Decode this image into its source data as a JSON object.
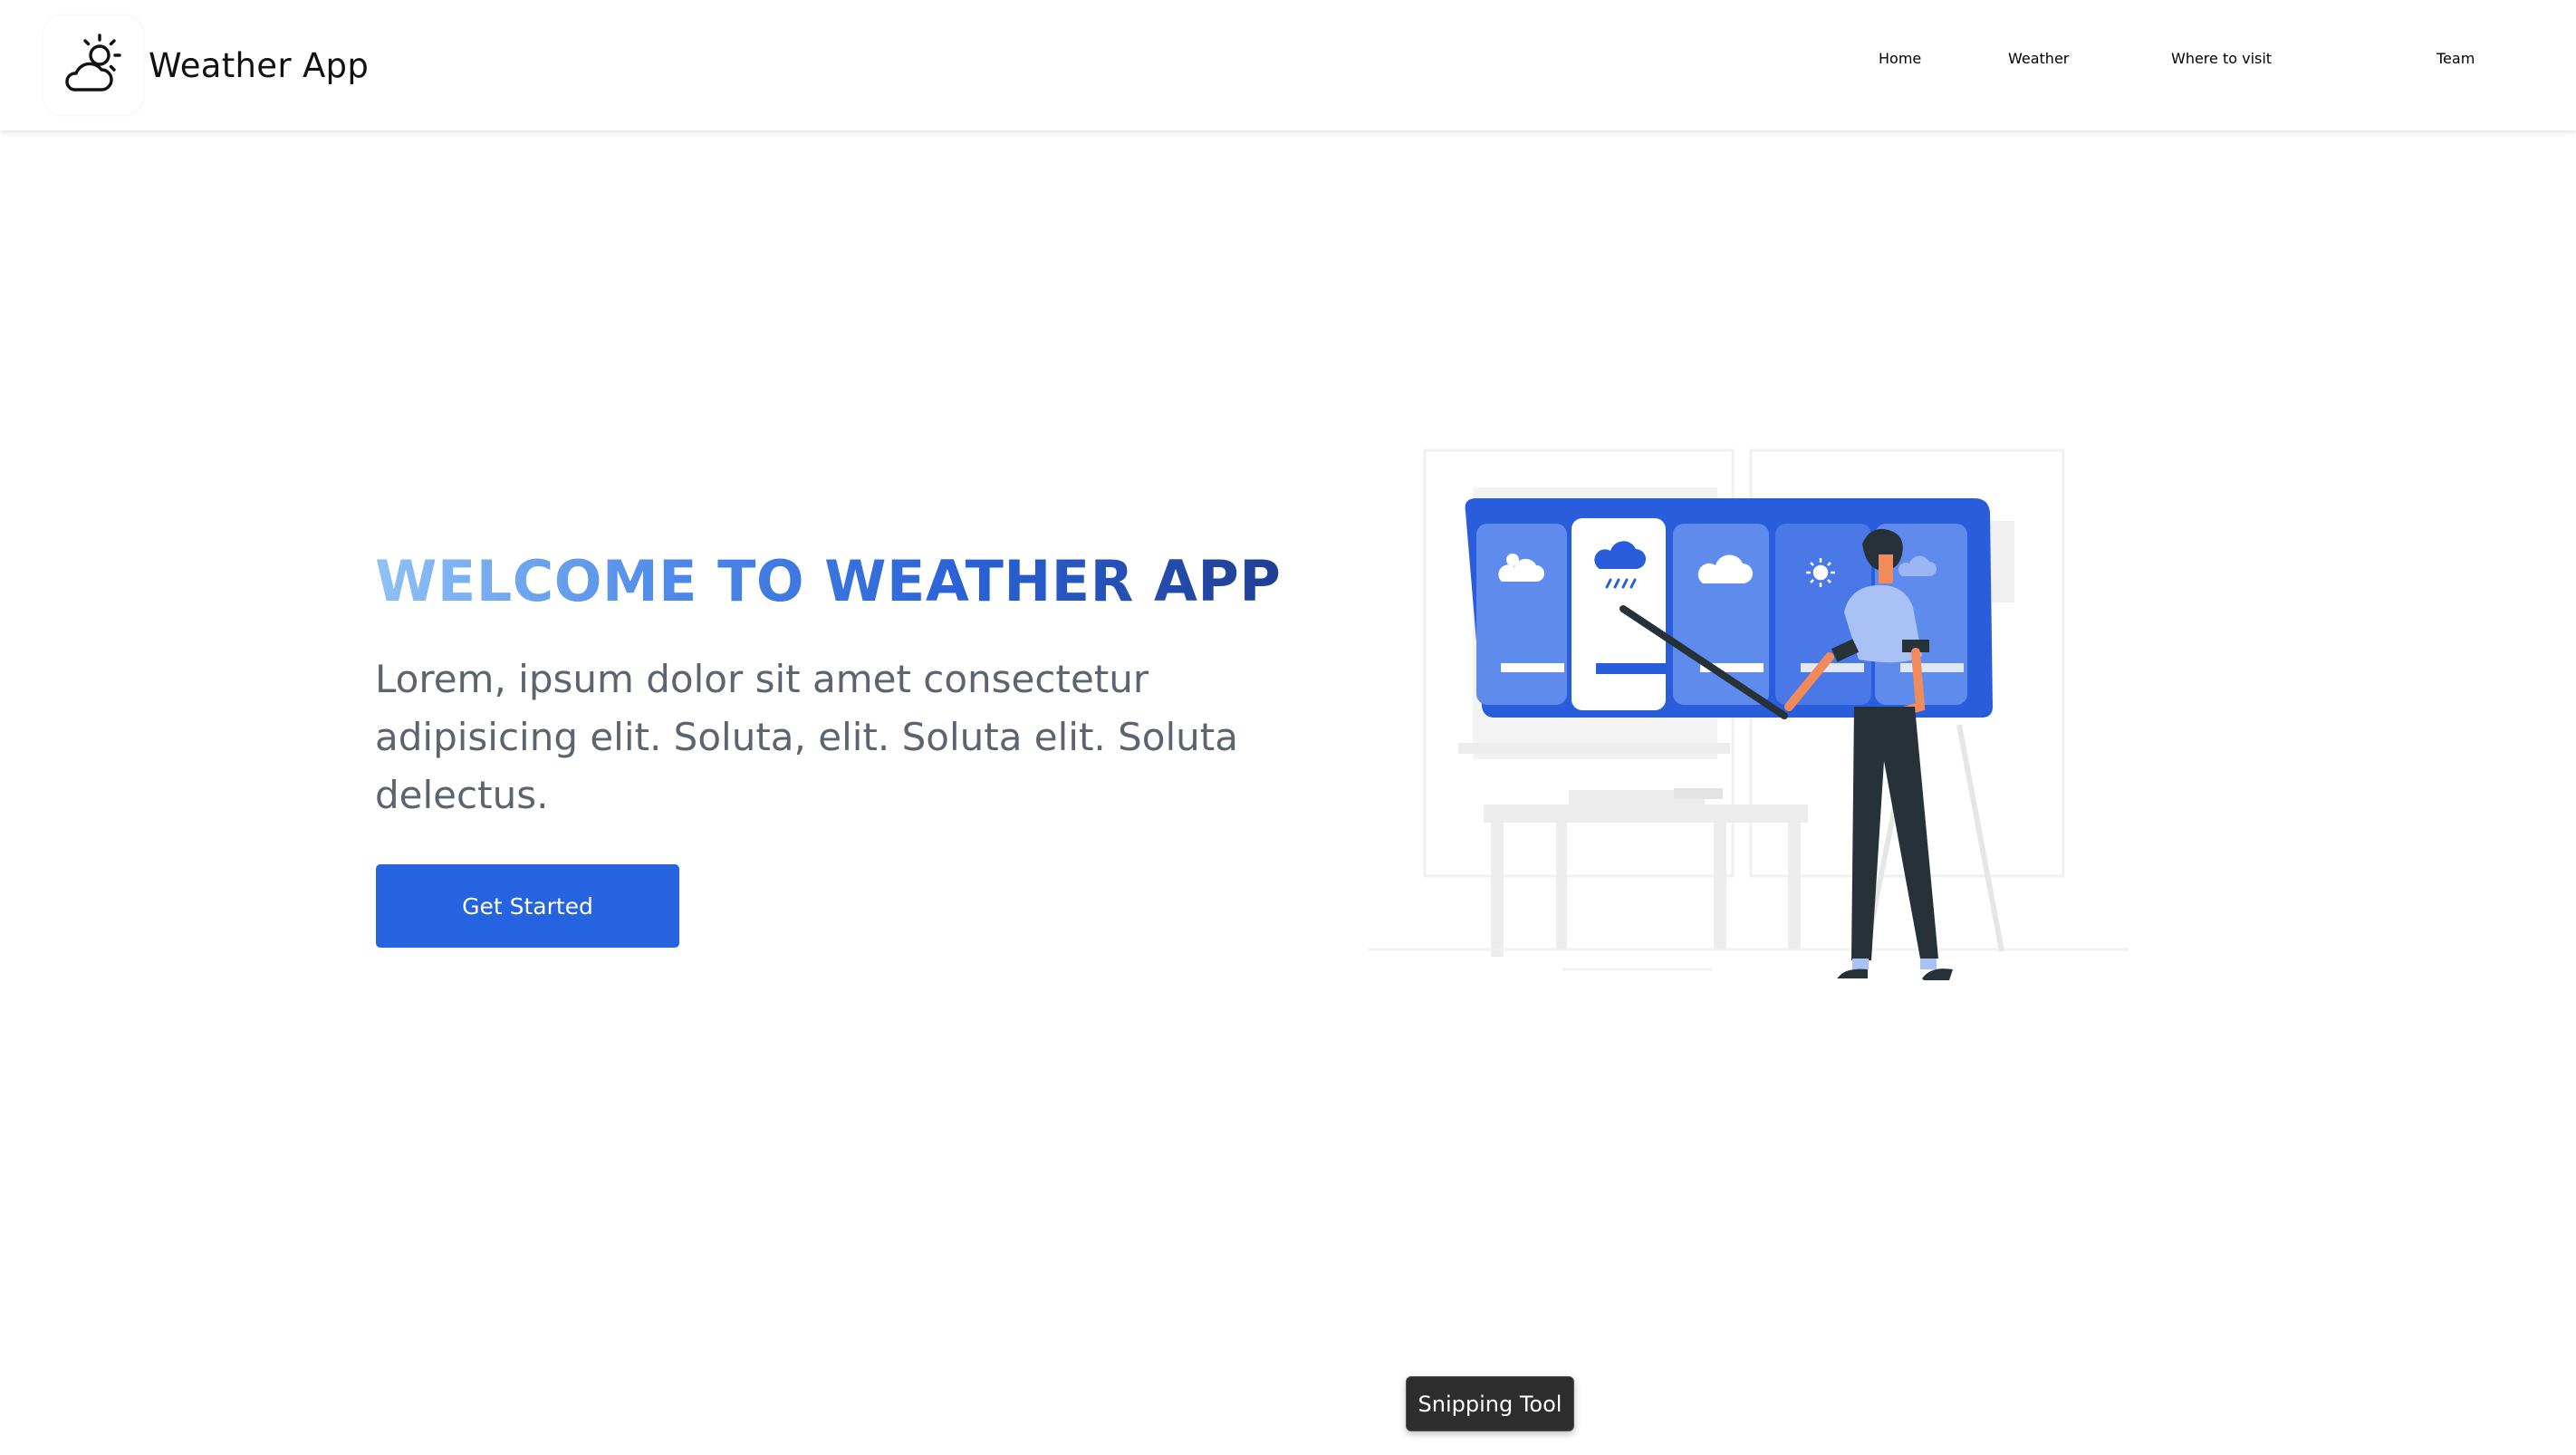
{
  "brand": {
    "title": "Weather App",
    "logo_icon": "cloud-sun-icon"
  },
  "nav": {
    "items": [
      {
        "label": "Home"
      },
      {
        "label": "Weather"
      },
      {
        "label": "Where to visit"
      },
      {
        "label": "Team"
      }
    ]
  },
  "hero": {
    "title": "WELCOME TO WEATHER APP",
    "description": "Lorem, ipsum dolor sit amet consectetur adipisicing elit. Soluta, elit. Soluta elit. Soluta delectus.",
    "cta_label": "Get Started"
  },
  "illustration": {
    "subject": "person-pointing-at-weather-board",
    "cards": [
      "partly-cloudy-icon",
      "rain-cloud-icon",
      "cloud-icon",
      "sun-icon",
      "rain-cloud-icon"
    ]
  },
  "tooltip": {
    "label": "Snipping Tool"
  },
  "colors": {
    "accent": "#2563e0",
    "title_gradient": [
      "#8fc1f5",
      "#4a86e8",
      "#2a62d6",
      "#1f3f94"
    ],
    "text": "#5c6470"
  }
}
